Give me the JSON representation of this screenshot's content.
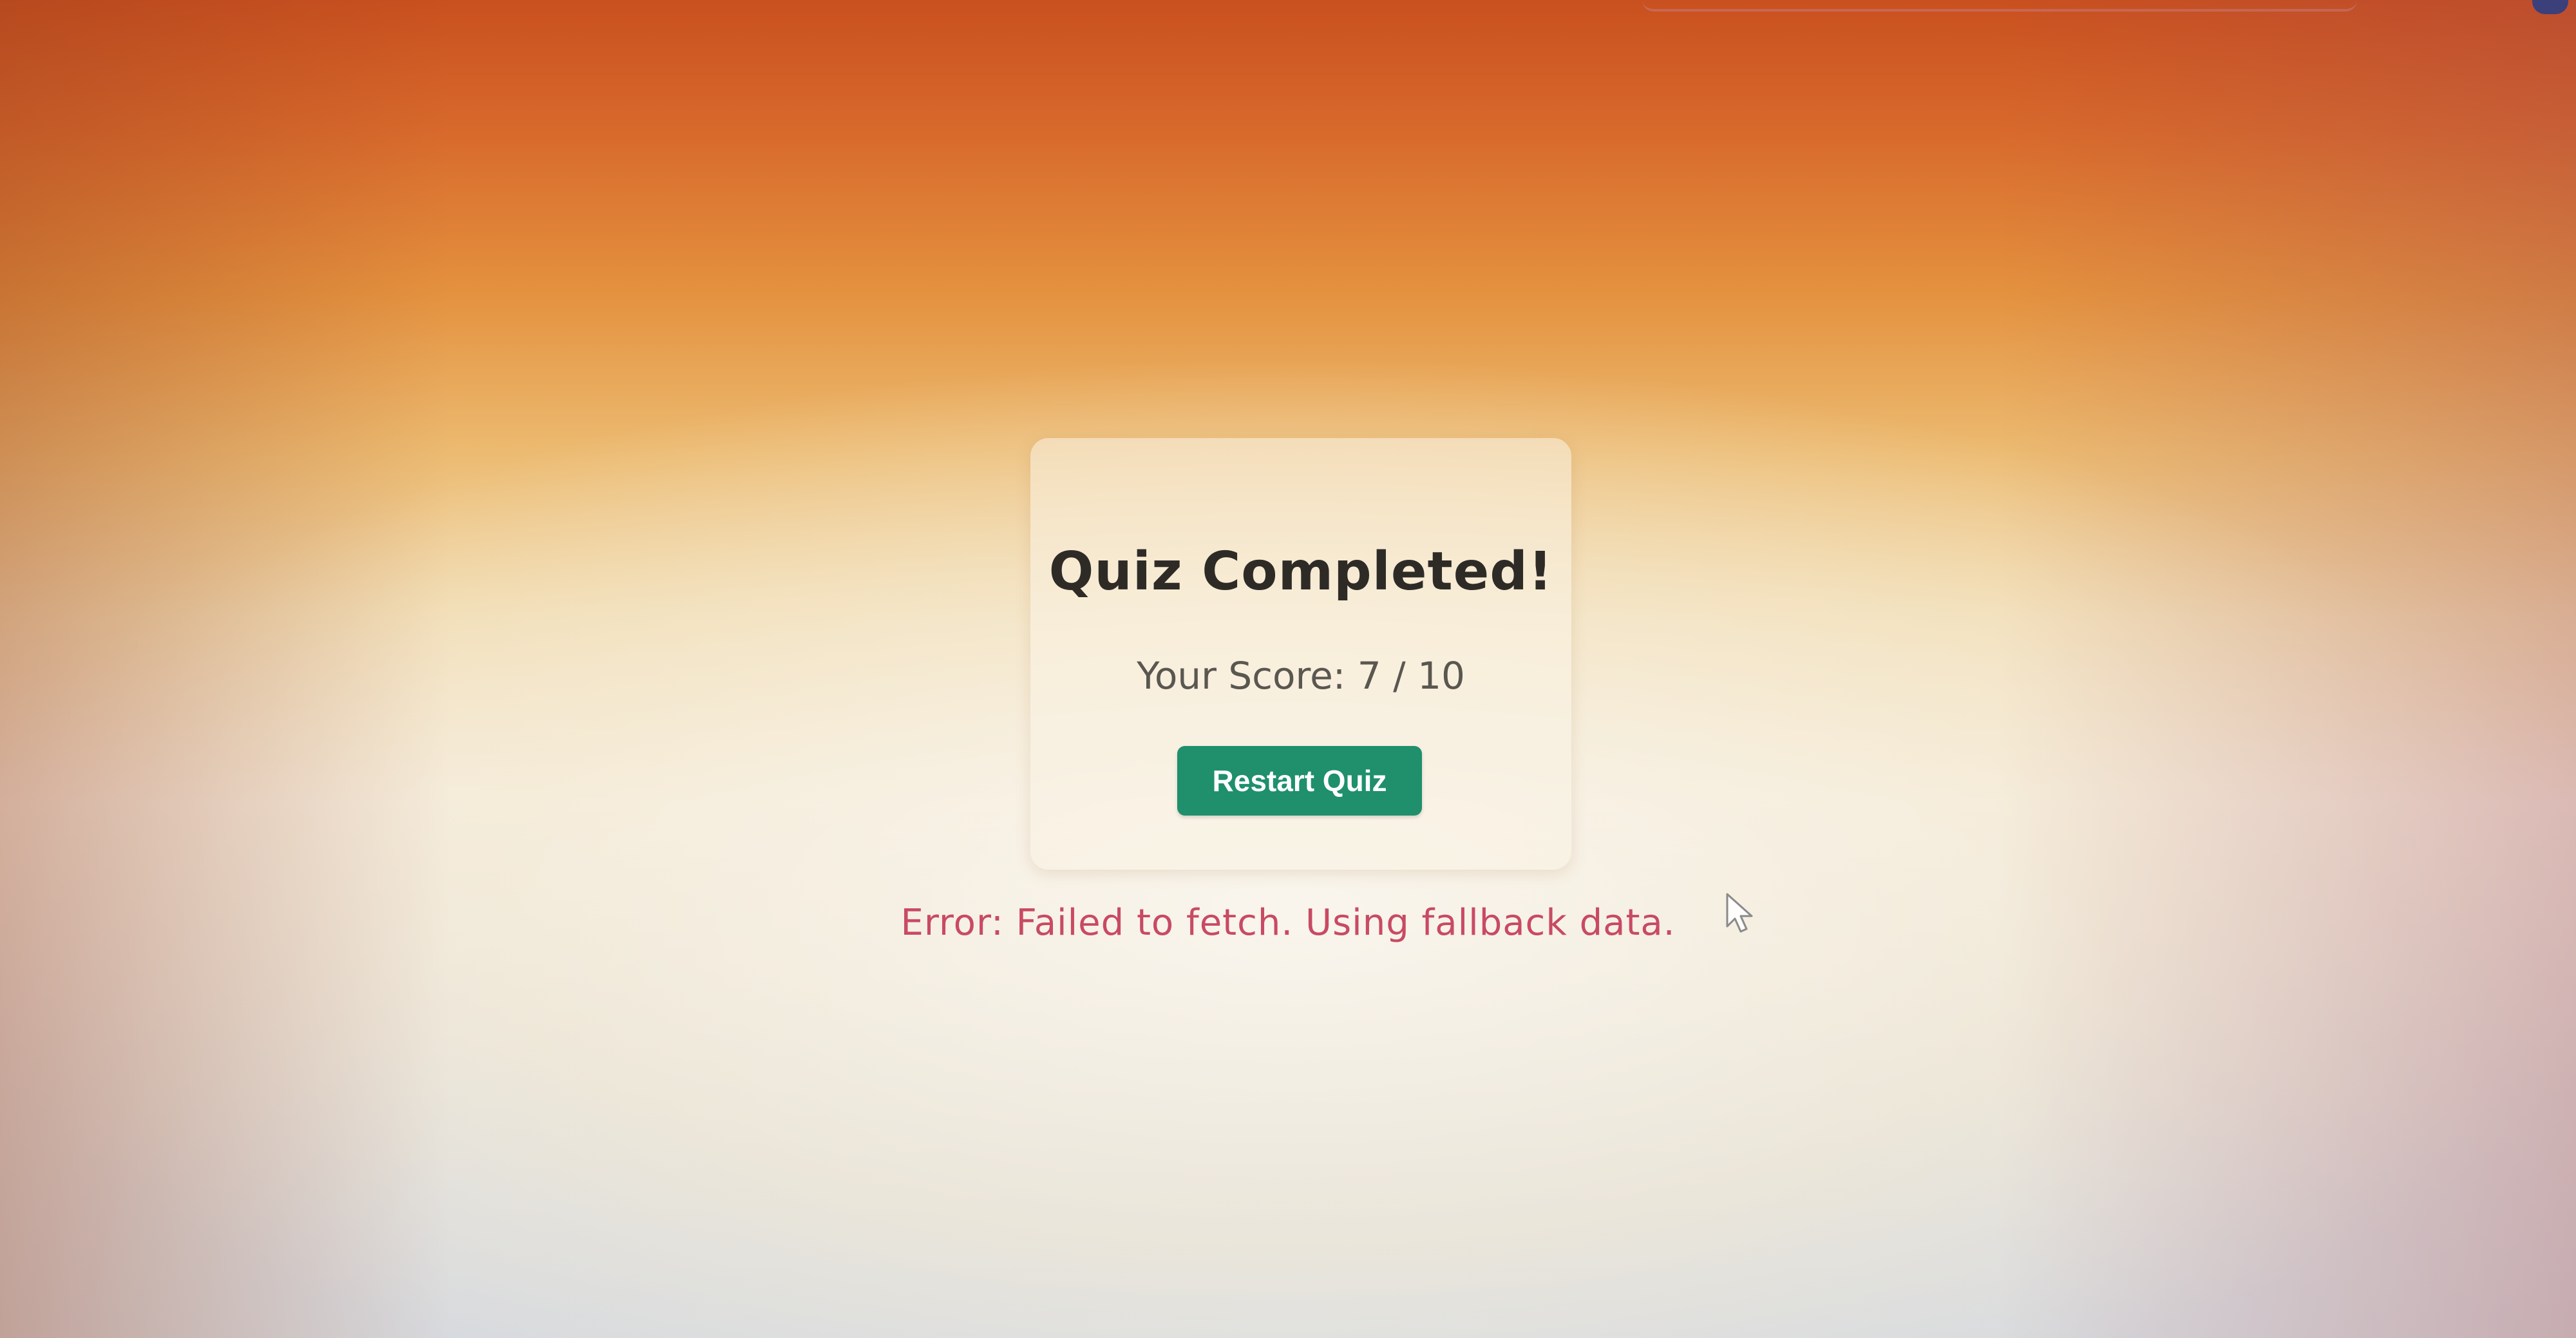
{
  "quiz": {
    "title": "Quiz Completed!",
    "score_text": "Your Score: 7 / 10",
    "score": 7,
    "total": 10,
    "restart_label": "Restart Quiz"
  },
  "status": {
    "error_text": "Error: Failed to fetch. Using fallback data."
  },
  "icons": {
    "cursor": "mouse-pointer-icon"
  },
  "colors": {
    "button": "#1f8f6c",
    "error": "#c84a63",
    "title": "#2e2b27"
  }
}
